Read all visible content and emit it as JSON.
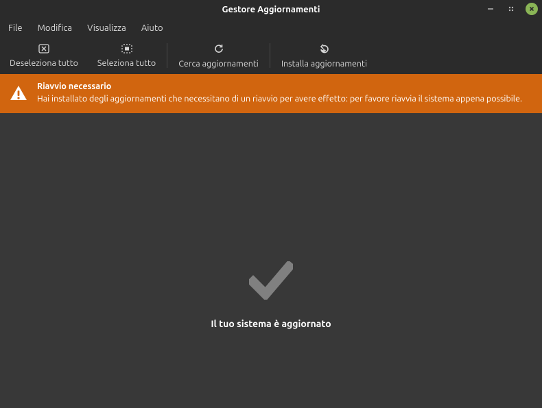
{
  "titlebar": {
    "title": "Gestore Aggiornamenti"
  },
  "menubar": {
    "file": "File",
    "edit": "Modifica",
    "view": "Visualizza",
    "help": "Aiuto"
  },
  "toolbar": {
    "deselect_all": "Deseleziona tutto",
    "select_all": "Seleziona tutto",
    "refresh": "Cerca aggiornamenti",
    "install": "Installa aggiornamenti"
  },
  "banner": {
    "title": "Riavvio necessario",
    "message": "Hai installato degli aggiornamenti che necessitano di un riavvio per avere effetto: per favore riavvia il sistema appena possibile."
  },
  "main": {
    "status": "Il tuo sistema è aggiornato"
  }
}
